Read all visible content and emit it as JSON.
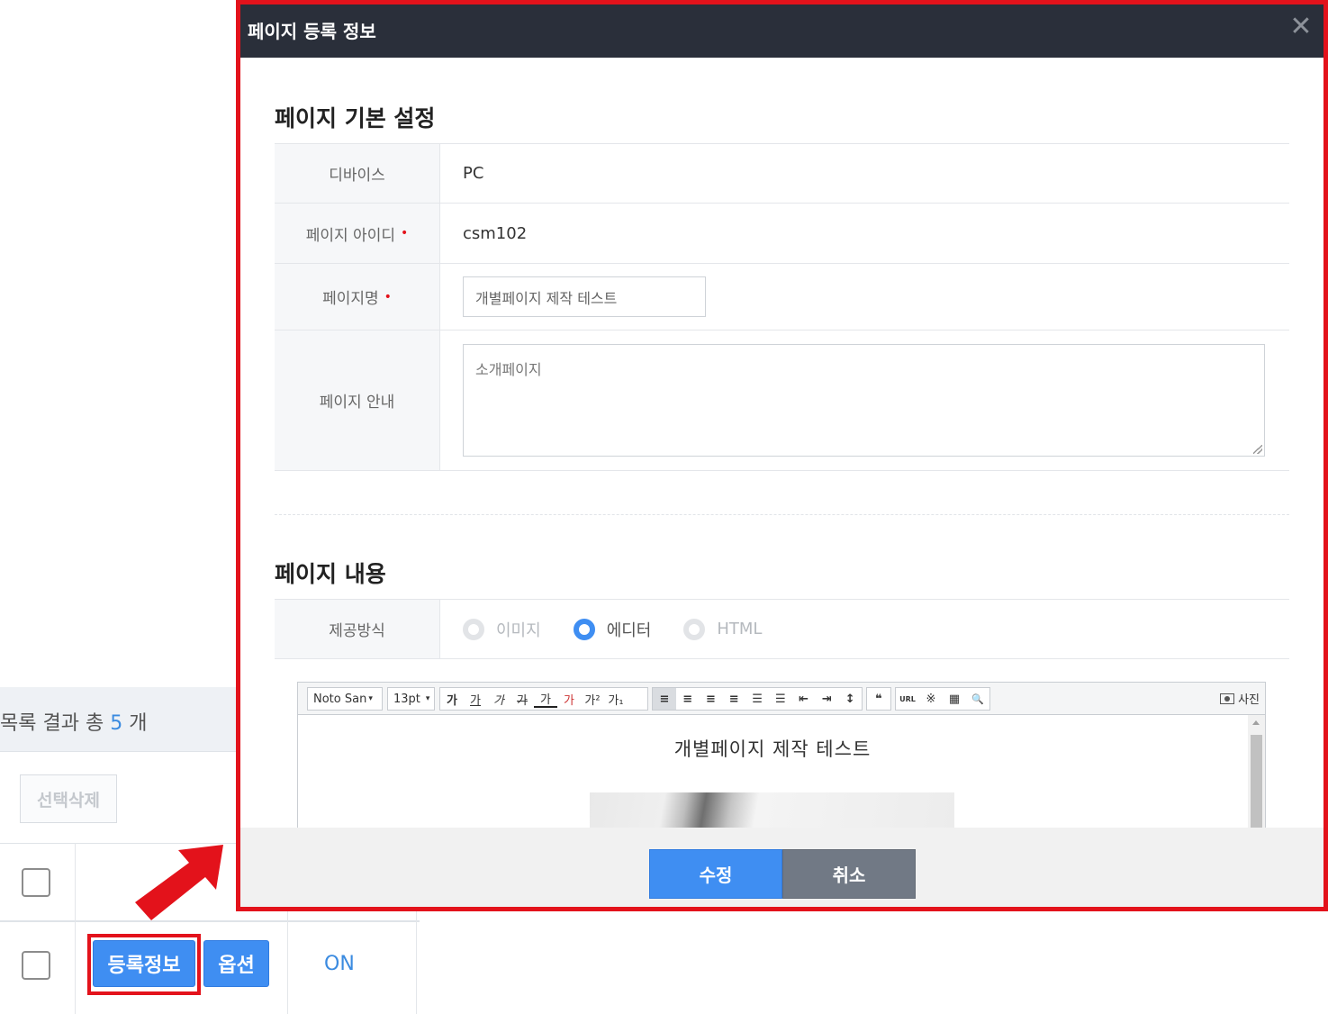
{
  "background": {
    "summary": {
      "prefix": "목록 결과 총",
      "count": "5",
      "suffix": "개"
    },
    "delete_button": "선택삭제",
    "row": {
      "info_button": "등록정보",
      "option_button": "옵션",
      "status": "ON"
    }
  },
  "modal": {
    "title": "페이지 등록 정보",
    "close_symbol": "✕",
    "basic": {
      "title": "페이지 기본 설정",
      "device_label": "디바이스",
      "device_value": "PC",
      "page_id_label": "페이지 아이디",
      "page_id_value": "csm102",
      "page_name_label": "페이지명",
      "page_name_value": "개별페이지 제작 테스트",
      "guide_label": "페이지 안내",
      "guide_value": "소개페이지",
      "required_mark": "•"
    },
    "content": {
      "title": "페이지 내용",
      "method_label": "제공방식",
      "options": [
        {
          "label": "이미지",
          "selected": false
        },
        {
          "label": "에디터",
          "selected": true
        },
        {
          "label": "HTML",
          "selected": false
        }
      ]
    },
    "editor": {
      "font": "Noto San",
      "size": "13pt",
      "toolbar_icons": [
        "bold-icon",
        "underline-icon",
        "italic-icon",
        "strikethrough-icon",
        "font-color-icon",
        "highlight-color-icon",
        "superscript-icon",
        "subscript-icon",
        "align-left-icon",
        "align-center-icon",
        "align-right-icon",
        "align-justify-icon",
        "ordered-list-icon",
        "unordered-list-icon",
        "outdent-icon",
        "indent-icon",
        "line-height-icon",
        "quote-icon",
        "link-icon",
        "special-char-icon",
        "table-icon",
        "find-icon"
      ],
      "glyphs": {
        "bold": "가",
        "underline": "가",
        "italic": "가",
        "strike": "가",
        "color": "가",
        "highlight": "가",
        "sup": "가²",
        "sub": "가₁",
        "align_left": "≡",
        "align_center": "≡",
        "align_right": "≡",
        "align_justify": "≡",
        "ol": "☰",
        "ul": "☰",
        "outdent": "⇤",
        "indent": "⇥",
        "lineheight": "↕",
        "quote": "❝",
        "url": "URL",
        "special": "※",
        "table": "▦",
        "find": "🔍"
      },
      "photo_label": "사진",
      "content_text": "개별페이지 제작 테스트"
    },
    "footer": {
      "save": "수정",
      "cancel": "취소"
    }
  },
  "accent_colors": {
    "primary": "#3f8ef2",
    "highlight_red": "#e3121b",
    "header_dark": "#2a2f3a"
  }
}
